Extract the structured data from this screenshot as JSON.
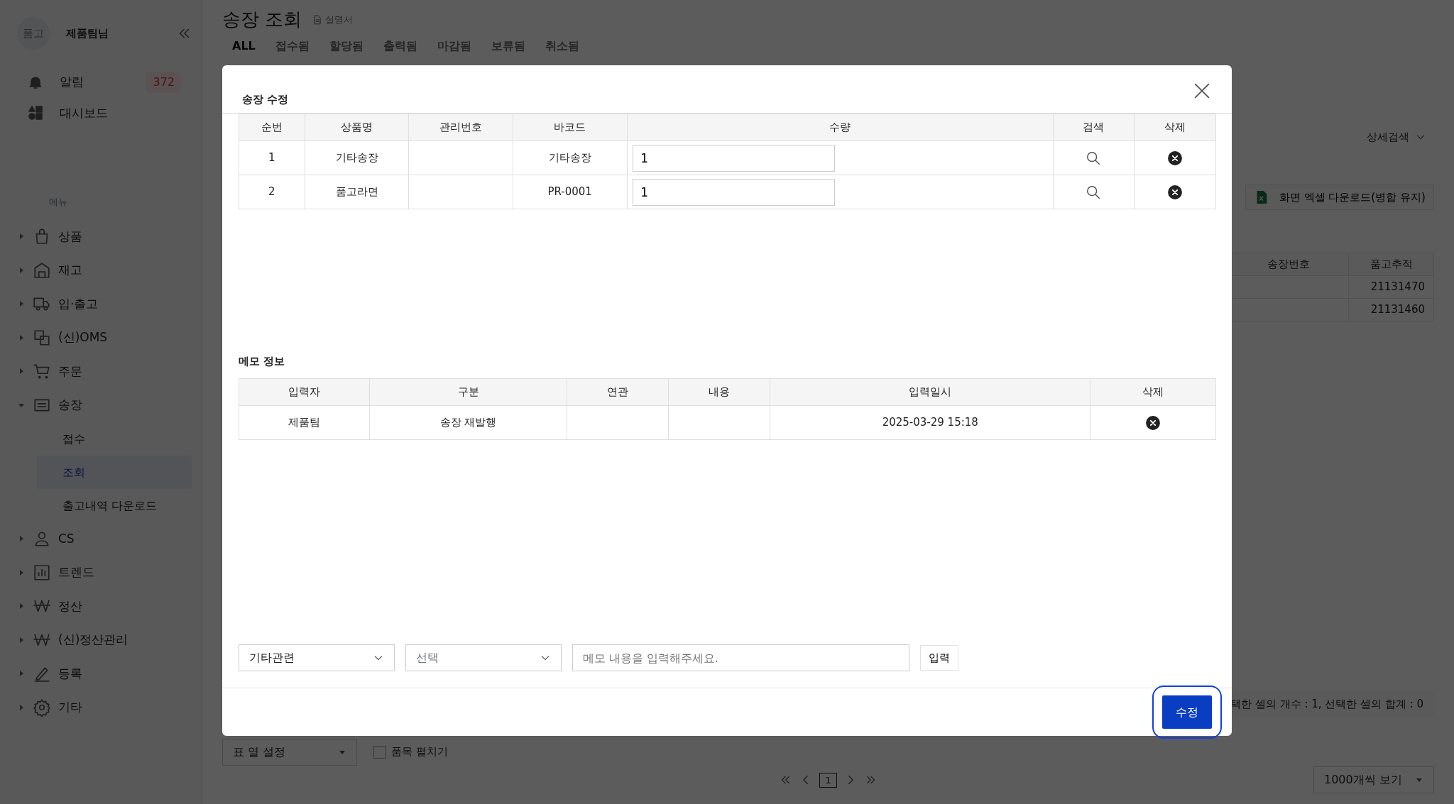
{
  "sidebar": {
    "avatar": "품고",
    "user": "제품팀님",
    "top_items": [
      {
        "label": "알림",
        "badge": "372"
      },
      {
        "label": "대시보드"
      }
    ],
    "menu_label": "메뉴",
    "items": [
      {
        "label": "상품",
        "expanded": false
      },
      {
        "label": "재고",
        "expanded": false
      },
      {
        "label": "입·출고",
        "expanded": false
      },
      {
        "label": "(신)OMS",
        "expanded": false
      },
      {
        "label": "주문",
        "expanded": false
      },
      {
        "label": "송장",
        "expanded": true,
        "children": [
          {
            "label": "접수",
            "selected": false
          },
          {
            "label": "조회",
            "selected": true
          },
          {
            "label": "출고내역 다운로드",
            "selected": false
          }
        ]
      },
      {
        "label": "CS",
        "expanded": false
      },
      {
        "label": "트렌드",
        "expanded": false
      },
      {
        "label": "정산",
        "expanded": false
      },
      {
        "label": "(신)정산관리",
        "expanded": false
      },
      {
        "label": "등록",
        "expanded": false
      },
      {
        "label": "기타",
        "expanded": false
      }
    ]
  },
  "page": {
    "title": "송장 조회",
    "help_link": "설명서",
    "tabs": [
      {
        "label": "ALL",
        "selected": true
      },
      {
        "label": "접수됨",
        "selected": false
      },
      {
        "label": "할당됨",
        "selected": false
      },
      {
        "label": "출력됨",
        "selected": false
      },
      {
        "label": "마감됨",
        "selected": false
      },
      {
        "label": "보류됨",
        "selected": false
      },
      {
        "label": "취소됨",
        "selected": false
      }
    ],
    "detail_search": "상세검색",
    "excel_button": "화면 엑셀 다운로드(병합 유지)",
    "grid": {
      "columns": [
        "송장번호",
        "품고추적"
      ],
      "rows": [
        {
          "column_2": "21131470"
        },
        {
          "column_2": "21131460"
        }
      ]
    },
    "status": "택한 셀의 개수 : 1, 선택한 셀의 합계 : 0",
    "column_setting": "표 열 설정",
    "expand_items": {
      "label": "품목 펼치기",
      "checked": false
    },
    "pages": [
      {
        "label": "1",
        "selected": true
      }
    ],
    "page_size": "1000개씩 보기"
  },
  "modal": {
    "title": "송장 수정",
    "items_table": {
      "columns": [
        "순번",
        "상품명",
        "관리번호",
        "바코드",
        "수량",
        "검색",
        "삭제"
      ],
      "rows": [
        {
          "no": "1",
          "name": "기타송장",
          "barcode": "기타송장",
          "qty": "1"
        },
        {
          "no": "2",
          "name": "품고라면",
          "barcode": "PR-0001",
          "qty": "1"
        }
      ]
    },
    "memo_title": "메모 정보",
    "memo_table": {
      "columns": [
        "입력자",
        "구분",
        "연관",
        "내용",
        "입력일시",
        "삭제"
      ],
      "rows": [
        {
          "author": "제품팀",
          "category": "송장 재발행",
          "datetime": "2025-03-29 15:18"
        }
      ]
    },
    "memo_form": {
      "category": "기타관련",
      "type_placeholder": "선택",
      "content_placeholder": "메모 내용을 입력해주세요.",
      "submit": "입력"
    },
    "save_button": {
      "label": "수정",
      "focused": true
    }
  }
}
